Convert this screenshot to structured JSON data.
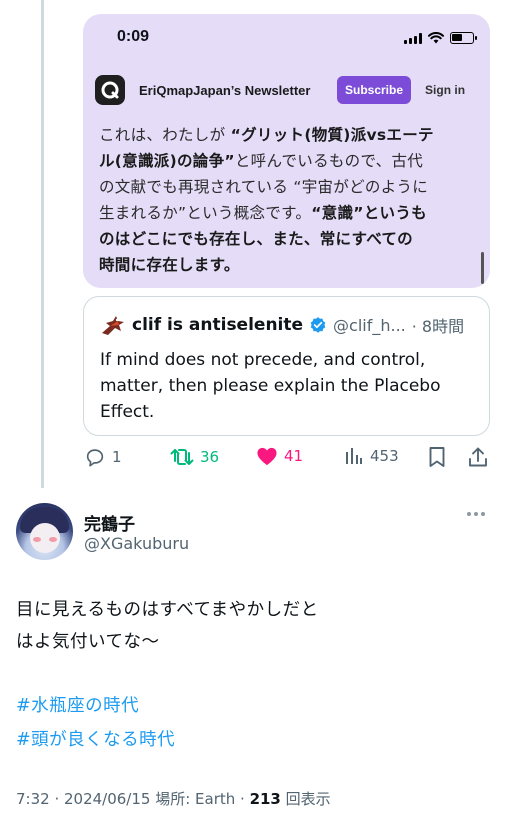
{
  "embedded_screenshot": {
    "status_time": "0:09",
    "newsletter_name": "EriQmapJapan’s Newsletter",
    "subscribe_label": "Subscribe",
    "sign_in_label": "Sign in",
    "body_lines": [
      [
        {
          "t": "これは、わたしが "
        },
        {
          "t": "“グリット(物質)派vsエーテ",
          "b": true
        }
      ],
      [
        {
          "t": "ル(意識派)の論争”",
          "b": true
        },
        {
          "t": "と呼んでいるもので、古代"
        }
      ],
      [
        {
          "t": "の文献でも再現されている “宇宙がどのように"
        }
      ],
      [
        {
          "t": "生まれるか”という概念です。"
        },
        {
          "t": "“意識”というも",
          "b": true
        }
      ],
      [
        {
          "t": "のはどこにでも存在し、また、常にすべての",
          "b": true
        }
      ],
      [
        {
          "t": "時間に存在します。",
          "b": true
        }
      ]
    ]
  },
  "quoted_tweet": {
    "name": "clif is antiselenite",
    "handle": "@clif_h...",
    "time": "· 8時間",
    "text_lines": [
      "If mind does not precede, and control,",
      "matter, then please explain the Placebo",
      "Effect."
    ]
  },
  "actions": {
    "replies": "1",
    "reposts": "36",
    "likes": "41",
    "views": "453",
    "repost_color": "#00ba7c",
    "like_color": "#f91880"
  },
  "reply_tweet": {
    "name": "完鶴子",
    "handle": "@XGakuburu",
    "text_lines": [
      "目に見えるものはすべてまやかしだと",
      "はよ気付いてな〜"
    ],
    "hashtags": [
      "#水瓶座の時代",
      "#頭が良くなる時代"
    ],
    "meta_prefix": "7:32 · 2024/06/15 場所: Earth · ",
    "view_count": "213",
    "view_label": " 回表示"
  }
}
